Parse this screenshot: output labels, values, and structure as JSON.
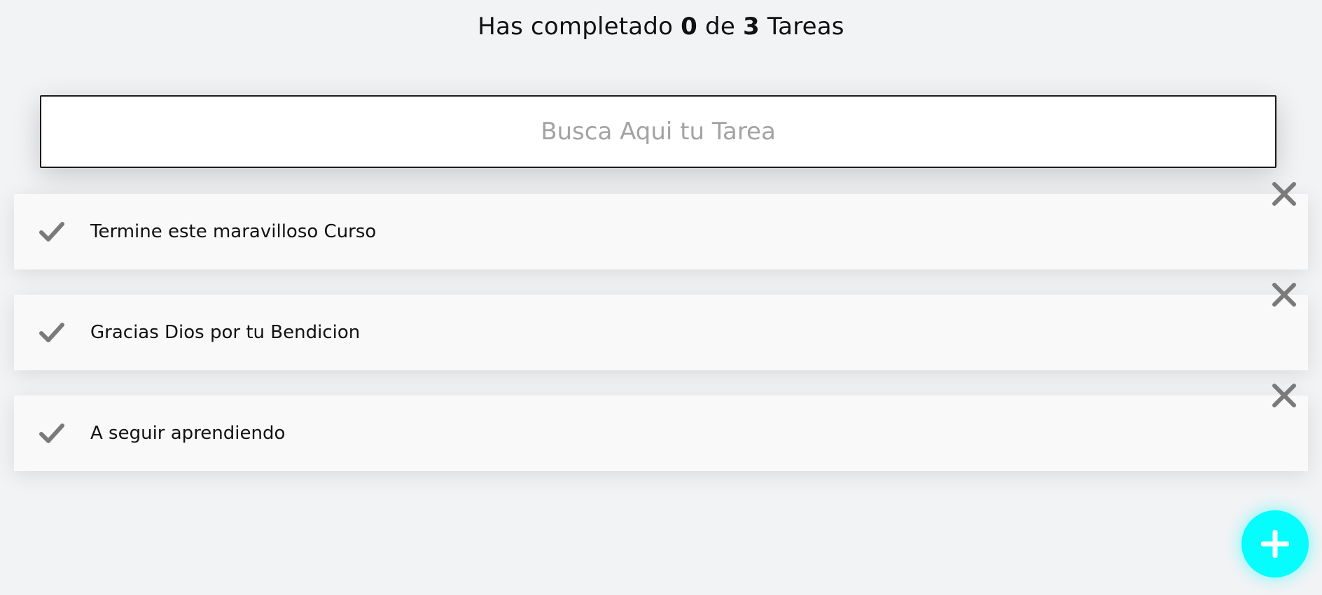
{
  "header": {
    "prefix": "Has completado",
    "completed": "0",
    "middle": "de",
    "total": "3",
    "suffix": "Tareas"
  },
  "search": {
    "placeholder": "Busca Aqui tu Tarea",
    "value": ""
  },
  "todos": [
    {
      "text": "Termine este maravilloso Curso",
      "completed": false
    },
    {
      "text": "Gracias Dios por tu Bendicion",
      "completed": false
    },
    {
      "text": "A seguir aprendiendo",
      "completed": false
    }
  ],
  "icons": {
    "complete": "check-icon",
    "delete": "close-icon",
    "add": "plus-icon"
  },
  "colors": {
    "background": "#f2f3f5",
    "item_background": "#f9f9f9",
    "icon_gray": "#7a7a7a",
    "fab": "#05fdfd"
  }
}
